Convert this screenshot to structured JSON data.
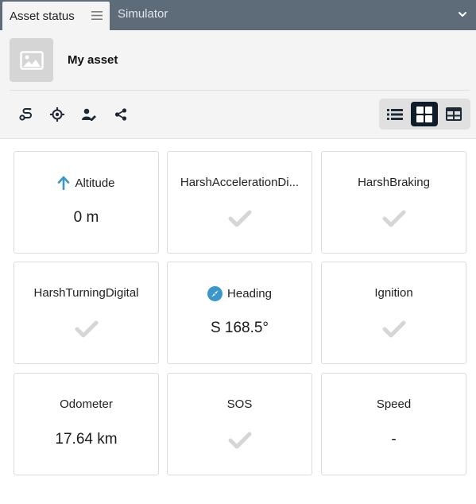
{
  "tabs": {
    "active_label": "Asset status",
    "inactive_label": "Simulator"
  },
  "asset": {
    "name": "My asset"
  },
  "toolbar": {
    "icons": [
      "route-icon",
      "locate-icon",
      "assign-user-icon",
      "share-icon"
    ]
  },
  "view_modes": {
    "selected": "tiles",
    "options": [
      "list",
      "tiles",
      "table"
    ]
  },
  "cards": [
    {
      "title": "Altitude",
      "value": "0 m",
      "icon": "arrow-up-icon"
    },
    {
      "title": "HarshAccelerationDi...",
      "value": null,
      "icon": null
    },
    {
      "title": "HarshBraking",
      "value": null,
      "icon": null
    },
    {
      "title": "HarshTurningDigital",
      "value": null,
      "icon": null
    },
    {
      "title": "Heading",
      "value": "S 168.5°",
      "icon": "compass-icon"
    },
    {
      "title": "Ignition",
      "value": null,
      "icon": null
    },
    {
      "title": "Odometer",
      "value": "17.64 km",
      "icon": null
    },
    {
      "title": "SOS",
      "value": null,
      "icon": null
    },
    {
      "title": "Speed",
      "value": "-",
      "icon": null
    }
  ],
  "colors": {
    "tabbar": "#5e6b78",
    "panel": "#f4f4f4",
    "accent_blue": "#3b97c9",
    "check_gray": "#d6d6d6",
    "active_view": "#0f1c2a"
  }
}
